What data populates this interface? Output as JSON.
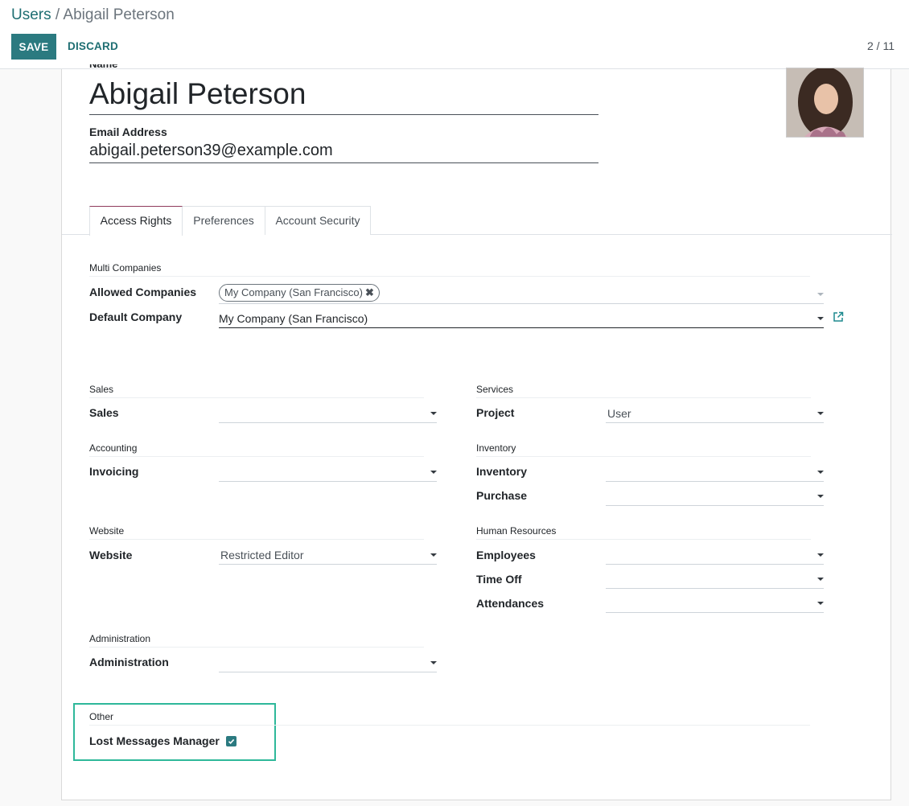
{
  "breadcrumb": {
    "parent": "Users",
    "separator": " / ",
    "current": "Abigail Peterson"
  },
  "toolbar": {
    "save_label": "SAVE",
    "discard_label": "DISCARD"
  },
  "pager": {
    "text": "2 / 11"
  },
  "form": {
    "name_label": "Name",
    "name_value": "Abigail Peterson",
    "email_label": "Email Address",
    "email_value": "abigail.peterson39@example.com"
  },
  "tabs": [
    {
      "label": "Access Rights",
      "active": true
    },
    {
      "label": "Preferences",
      "active": false
    },
    {
      "label": "Account Security",
      "active": false
    }
  ],
  "multi_companies": {
    "title": "Multi Companies",
    "allowed_label": "Allowed Companies",
    "allowed_tag": "My Company (San Francisco)",
    "default_label": "Default Company",
    "default_value": "My Company (San Francisco)"
  },
  "sections": {
    "sales": {
      "title": "Sales",
      "fields": [
        {
          "label": "Sales",
          "value": ""
        }
      ]
    },
    "services": {
      "title": "Services",
      "fields": [
        {
          "label": "Project",
          "value": "User"
        }
      ]
    },
    "accounting": {
      "title": "Accounting",
      "fields": [
        {
          "label": "Invoicing",
          "value": ""
        }
      ]
    },
    "inventory": {
      "title": "Inventory",
      "fields": [
        {
          "label": "Inventory",
          "value": ""
        },
        {
          "label": "Purchase",
          "value": ""
        }
      ]
    },
    "website": {
      "title": "Website",
      "fields": [
        {
          "label": "Website",
          "value": "Restricted Editor"
        }
      ]
    },
    "human_resources": {
      "title": "Human Resources",
      "fields": [
        {
          "label": "Employees",
          "value": ""
        },
        {
          "label": "Time Off",
          "value": ""
        },
        {
          "label": "Attendances",
          "value": ""
        }
      ]
    },
    "administration": {
      "title": "Administration",
      "fields": [
        {
          "label": "Administration",
          "value": ""
        }
      ]
    },
    "other": {
      "title": "Other",
      "fields": [
        {
          "label": "Lost Messages Manager",
          "checked": true
        }
      ]
    }
  },
  "colors": {
    "primary": "#2b7a80",
    "highlight_box": "#2eb89a",
    "active_tab_top": "#8f3a5c"
  }
}
